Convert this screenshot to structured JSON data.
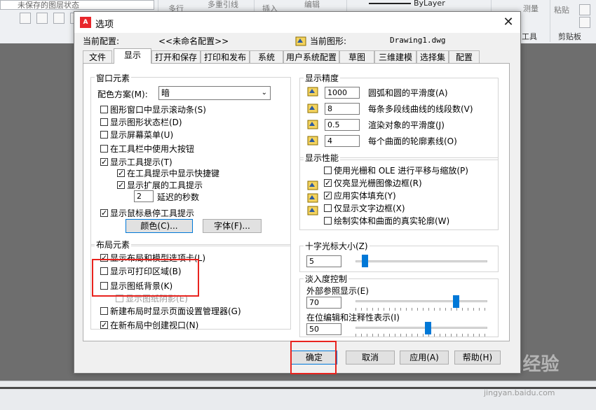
{
  "ribbon": {
    "layer_state": "未保存的图层状态",
    "multiline": "多行",
    "multileader": "多重引线",
    "insert": "插入",
    "edit": "编辑",
    "bylayer": "ByLayer",
    "measure": "测量",
    "paste": "粘贴",
    "tools": "工具",
    "clipboard": "剪贴板"
  },
  "dialog": {
    "title": "选项",
    "current_profile_label": "当前配置:",
    "current_profile_value": "<<未命名配置>>",
    "current_drawing_label": "当前图形:",
    "current_drawing_value": "Drawing1.dwg",
    "tabs": [
      "文件",
      "显示",
      "打开和保存",
      "打印和发布",
      "系统",
      "用户系统配置",
      "草图",
      "三维建模",
      "选择集",
      "配置"
    ],
    "active_tab": "显示"
  },
  "window_elements": {
    "title": "窗口元素",
    "color_scheme_label": "配色方案(M):",
    "color_scheme_value": "暗",
    "items": [
      {
        "label": "图形窗口中显示滚动条(S)",
        "checked": false
      },
      {
        "label": "显示图形状态栏(D)",
        "checked": false
      },
      {
        "label": "显示屏幕菜单(U)",
        "checked": false
      },
      {
        "label": "在工具栏中使用大按钮",
        "checked": false
      },
      {
        "label": "显示工具提示(T)",
        "checked": true
      },
      {
        "label": "在工具提示中显示快捷键",
        "checked": true
      },
      {
        "label": "显示扩展的工具提示",
        "checked": true
      },
      {
        "label": "显示鼠标悬停工具提示",
        "checked": true
      }
    ],
    "delay_value": "2",
    "delay_label": "延迟的秒数",
    "colors_button": "颜色(C)...",
    "fonts_button": "字体(F)..."
  },
  "layout_elements": {
    "title": "布局元素",
    "items": [
      {
        "label": "显示布局和模型选项卡(L)",
        "checked": true
      },
      {
        "label": "显示可打印区域(B)",
        "checked": false
      },
      {
        "label": "显示图纸背景(K)",
        "checked": false
      },
      {
        "label": "显示图纸阴影(E)",
        "checked": false
      },
      {
        "label": "新建布局时显示页面设置管理器(G)",
        "checked": false
      },
      {
        "label": "在新布局中创建视口(N)",
        "checked": true
      }
    ]
  },
  "display_resolution": {
    "title": "显示精度",
    "items": [
      {
        "value": "1000",
        "label": "圆弧和圆的平滑度(A)"
      },
      {
        "value": "8",
        "label": "每条多段线曲线的线段数(V)"
      },
      {
        "value": "0.5",
        "label": "渲染对象的平滑度(J)"
      },
      {
        "value": "4",
        "label": "每个曲面的轮廓素线(O)"
      }
    ]
  },
  "display_performance": {
    "title": "显示性能",
    "items": [
      {
        "label": "使用光栅和 OLE 进行平移与缩放(P)",
        "checked": false
      },
      {
        "label": "仅亮显光栅图像边框(R)",
        "checked": true
      },
      {
        "label": "应用实体填充(Y)",
        "checked": true
      },
      {
        "label": "仅显示文字边框(X)",
        "checked": false
      },
      {
        "label": "绘制实体和曲面的真实轮廓(W)",
        "checked": false
      }
    ]
  },
  "crosshair": {
    "title": "十字光标大小(Z)",
    "value": "5",
    "level": 5
  },
  "fade_control": {
    "title": "淡入度控制",
    "xref_label": "外部参照显示(E)",
    "xref_value": "70",
    "xref_level": 70,
    "inplace_label": "在位编辑和注释性表示(I)",
    "inplace_value": "50",
    "inplace_level": 50
  },
  "buttons": {
    "ok": "确定",
    "cancel": "取消",
    "apply": "应用(A)",
    "help": "帮助(H)"
  },
  "watermark": {
    "brand": "Baidu经验",
    "url": "jingyan.baidu.com"
  },
  "colors": {
    "accent": "#0078d7",
    "highlight": "#e8231e"
  }
}
